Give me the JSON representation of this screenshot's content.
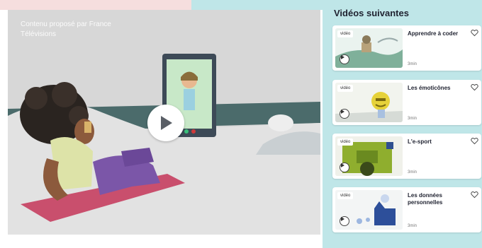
{
  "player": {
    "credit": "Contenu proposé par France Télévisions"
  },
  "sidebar": {
    "title": "Vidéos suivantes",
    "videos": [
      {
        "badge": "vidéo",
        "title": "Apprendre à coder",
        "duration": "3min"
      },
      {
        "badge": "vidéo",
        "title": "Les émoticônes",
        "duration": "3min"
      },
      {
        "badge": "vidéo",
        "title": "L'e-sport",
        "duration": "3min"
      },
      {
        "badge": "vidéo",
        "title": "Les données personnelles",
        "duration": "3min"
      }
    ]
  },
  "colors": {
    "sidebar_bg": "#bfe6e8",
    "player_bg": "#d7d7d7",
    "mat": "#c94f6d",
    "water": "#4b6b6b"
  },
  "icons": [
    "play-icon",
    "heart-icon"
  ]
}
